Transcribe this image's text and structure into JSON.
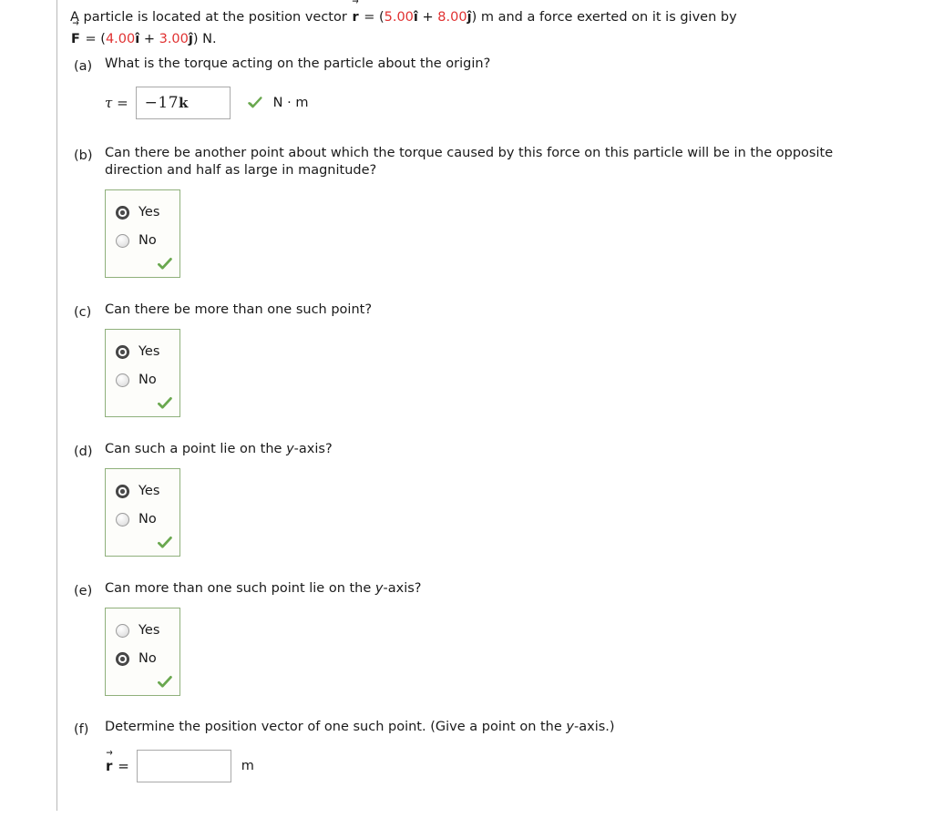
{
  "problem": {
    "line1_pre": "A particle is located at the position vector ",
    "vector_r": "r",
    "eq": " = (",
    "r_x": "5.00",
    "i_hat": "î",
    "plus": " + ",
    "r_y": "8.00",
    "j_hat": "ĵ",
    "line1_post": ") m and a force exerted on it is given by",
    "vector_F": "F",
    "F_x": "4.00",
    "F_y": "3.00",
    "line2_post": ") N."
  },
  "parts": [
    {
      "label": "(a)",
      "question": "What is the torque acting on the particle about the origin?",
      "type": "input",
      "input_label": "τ =",
      "input_value": "−17",
      "input_value_vec": "k",
      "unit": "N · m",
      "status": "correct",
      "status_icon": "green-check-icon"
    },
    {
      "label": "(b)",
      "question": "Can there be another point about which the torque caused by this force on this particle will be in the opposite direction and half as large in magnitude?",
      "type": "radio",
      "options": [
        "Yes",
        "No"
      ],
      "selected": "Yes",
      "status": "correct",
      "status_icon": "green-check-icon"
    },
    {
      "label": "(c)",
      "question": "Can there be more than one such point?",
      "type": "radio",
      "options": [
        "Yes",
        "No"
      ],
      "selected": "Yes",
      "status": "correct",
      "status_icon": "green-check-icon"
    },
    {
      "label": "(d)",
      "question_pre": "Can such a point lie on the ",
      "question_ital": "y",
      "question_post": "-axis?",
      "type": "radio",
      "options": [
        "Yes",
        "No"
      ],
      "selected": "Yes",
      "status": "correct",
      "status_icon": "green-check-icon"
    },
    {
      "label": "(e)",
      "question_pre": "Can more than one such point lie on the ",
      "question_ital": "y",
      "question_post": "-axis?",
      "type": "radio",
      "options": [
        "Yes",
        "No"
      ],
      "selected": "No",
      "status": "correct",
      "status_icon": "green-check-icon"
    },
    {
      "label": "(f)",
      "question_pre": "Determine the position vector of one such point. (Give a point on the ",
      "question_ital": "y",
      "question_post": "-axis.)",
      "type": "input",
      "input_label_vec": "r",
      "input_label_eq": "=",
      "input_value": "",
      "input_placeholder": "",
      "unit": "m"
    }
  ],
  "colors": {
    "value_red": "#e03131",
    "check_green": "#6aa84f",
    "box_border_green": "#8fb07b",
    "input_border_gray": "#a9a9a9",
    "rule_gray": "#b9b9b9"
  }
}
